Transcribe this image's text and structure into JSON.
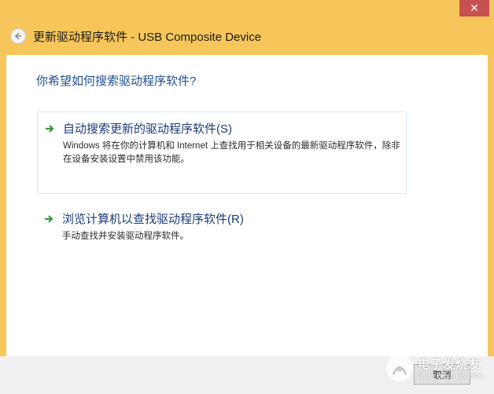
{
  "window": {
    "title": "更新驱动程序软件 - USB Composite Device",
    "close_glyph": "✕"
  },
  "question": "你希望如何搜索驱动程序软件?",
  "options": [
    {
      "title": "自动搜索更新的驱动程序软件(S)",
      "description": "Windows 将在你的计算机和 Internet 上查找用于相关设备的最新驱动程序软件，除非在设备安装设置中禁用该功能。"
    },
    {
      "title": "浏览计算机以查找驱动程序软件(R)",
      "description": "手动查找并安装驱动程序软件。"
    }
  ],
  "footer": {
    "cancel_label": "取消"
  },
  "watermark": {
    "cn": "电子发烧友",
    "en": "www.elecfans.com"
  },
  "colors": {
    "title_bar": "#f7c65a",
    "question": "#1f4e8c",
    "option_title": "#1c3c78",
    "arrow": "#2e9e3e"
  }
}
